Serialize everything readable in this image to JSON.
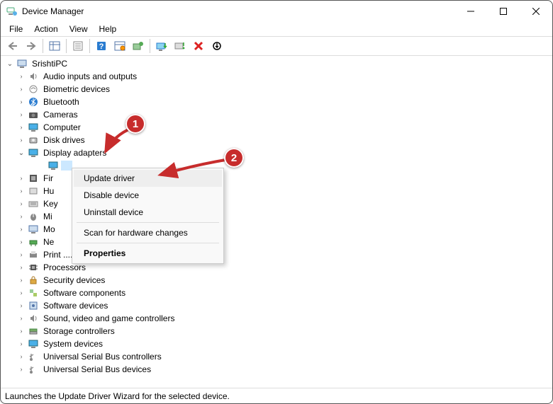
{
  "window": {
    "title": "Device Manager"
  },
  "menu": {
    "file": "File",
    "action": "Action",
    "view": "View",
    "help": "Help"
  },
  "tree": {
    "root": "SrishtiPC",
    "items": [
      "Audio inputs and outputs",
      "Biometric devices",
      "Bluetooth",
      "Cameras",
      "Computer",
      "Disk drives",
      "Display adapters",
      "Fir",
      "Hu",
      "Key",
      "Mi",
      "Mo",
      "Ne",
      "Print .......",
      "Processors",
      "Security devices",
      "Software components",
      "Software devices",
      "Sound, video and game controllers",
      "Storage controllers",
      "System devices",
      "Universal Serial Bus controllers",
      "Universal Serial Bus devices"
    ]
  },
  "context_menu": {
    "update": "Update driver",
    "disable": "Disable device",
    "uninstall": "Uninstall device",
    "scan": "Scan for hardware changes",
    "properties": "Properties"
  },
  "status": "Launches the Update Driver Wizard for the selected device.",
  "annotations": {
    "one": "1",
    "two": "2"
  }
}
